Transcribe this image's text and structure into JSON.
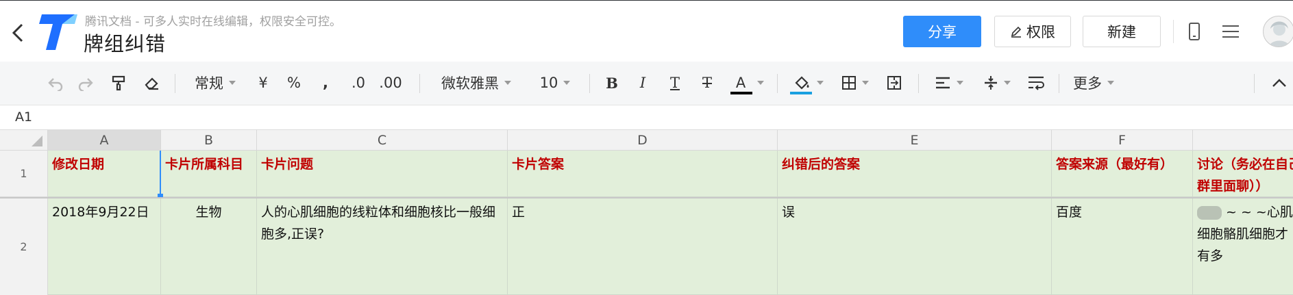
{
  "header": {
    "tagline": "腾讯文档 - 可多人实时在线编辑，权限安全可控。",
    "title": "牌组纠错",
    "share_label": "分享",
    "permission_label": "权限",
    "new_label": "新建",
    "accent_color": "#2f8dfa"
  },
  "toolbar": {
    "number_format": "常规",
    "currency": "¥",
    "percent": "%",
    "thousands": ",",
    "decrease_decimal": ".0",
    "increase_decimal": ".00",
    "font_family": "微软雅黑",
    "font_size": "10",
    "bold": "B",
    "italic": "I",
    "underline": "T",
    "strike": "T",
    "font_color_letter": "A",
    "more_label": "更多"
  },
  "formula_bar": {
    "cell_ref": "A1"
  },
  "grid": {
    "columns": [
      "A",
      "B",
      "C",
      "D",
      "E",
      "F"
    ],
    "rows": [
      "1",
      "2"
    ],
    "header_row": {
      "a": "修改日期",
      "b": "卡片所属科目",
      "c": "卡片问题",
      "d": "卡片答案",
      "e": "纠错后的答案",
      "f": "答案来源（最好有）",
      "g": "讨论（务必在自己去群里面聊））"
    },
    "data_row": {
      "a": "2018年9月22日",
      "b": "生物",
      "c": "人的心肌细胞的线粒体和细胞核比一般细胞多,正误?",
      "d": "正",
      "e": "误",
      "f": "百度",
      "g": "~ ~ ~心肌细胞骼肌细胞才有多"
    },
    "header_text_color": "#c00000",
    "cell_fill_color": "#e2efda"
  }
}
